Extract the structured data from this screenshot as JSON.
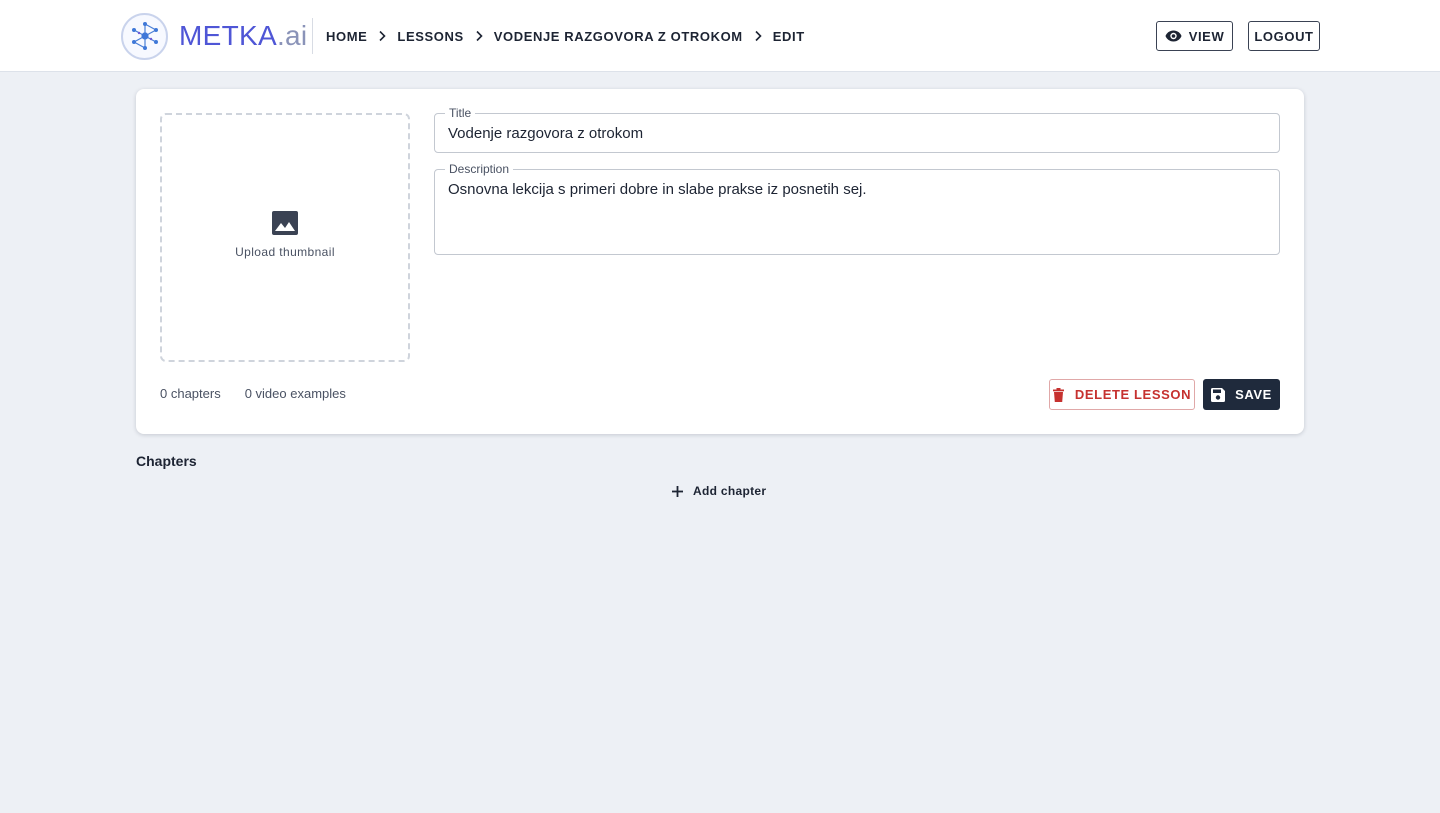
{
  "header": {
    "logo": {
      "main": "METKA",
      "suffix": ".ai"
    },
    "breadcrumb": [
      {
        "label": "HOME"
      },
      {
        "label": "LESSONS"
      },
      {
        "label": "VODENJE RAZGOVORA Z OTROKOM"
      },
      {
        "label": "EDIT"
      }
    ],
    "view_label": "VIEW",
    "logout_label": "LOGOUT",
    "icons": {
      "view": "eye-icon",
      "separator": "chevron-right-icon",
      "logo": "network-nodes-icon"
    }
  },
  "lesson": {
    "thumbnail": {
      "label": "Upload thumbnail",
      "icon": "image-icon"
    },
    "title": {
      "label": "Title",
      "value": "Vodenje razgovora z otrokom"
    },
    "description": {
      "label": "Description",
      "value": "Osnovna lekcija s primeri dobre in slabe prakse iz posnetih sej."
    },
    "stats": {
      "chapters": "0 chapters",
      "video_examples": "0 video examples"
    },
    "delete_label": "DELETE LESSON",
    "save_label": "SAVE",
    "icons": {
      "delete": "trash-icon",
      "save": "floppy-disk-icon"
    }
  },
  "chapters": {
    "heading": "Chapters",
    "add_label": "Add chapter",
    "icon": "plus-icon"
  },
  "colors": {
    "accent": "#4f56d6",
    "danger": "#c6312f",
    "primary_button": "#1f2a3c",
    "background": "#edf0f5"
  }
}
